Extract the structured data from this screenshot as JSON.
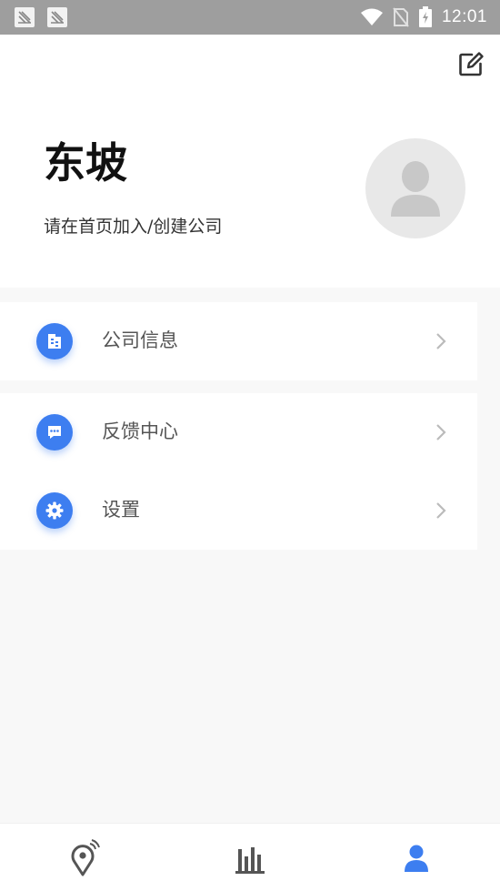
{
  "status_bar": {
    "time": "12:01",
    "icons": [
      "notification-app-icon",
      "notification-app-icon",
      "wifi-icon",
      "no-sim-icon",
      "battery-charging-icon"
    ]
  },
  "profile": {
    "name": "东坡",
    "subtitle": "请在首页加入/创建公司",
    "edit_icon": "edit-icon",
    "avatar_icon": "default-user-avatar"
  },
  "menu": {
    "group1": [
      {
        "label": "公司信息",
        "icon": "company-info-icon"
      }
    ],
    "group2": [
      {
        "label": "反馈中心",
        "icon": "feedback-icon"
      },
      {
        "label": "设置",
        "icon": "settings-gear-icon"
      }
    ]
  },
  "bottom_nav": [
    {
      "icon": "location-icon",
      "active": false
    },
    {
      "icon": "stats-icon",
      "active": false
    },
    {
      "icon": "user-icon",
      "active": true
    }
  ],
  "colors": {
    "accent": "#3d7ef0",
    "nav_inactive": "#555555",
    "status_bar": "#9e9e9e",
    "avatar_bg": "#e8e8e8"
  }
}
